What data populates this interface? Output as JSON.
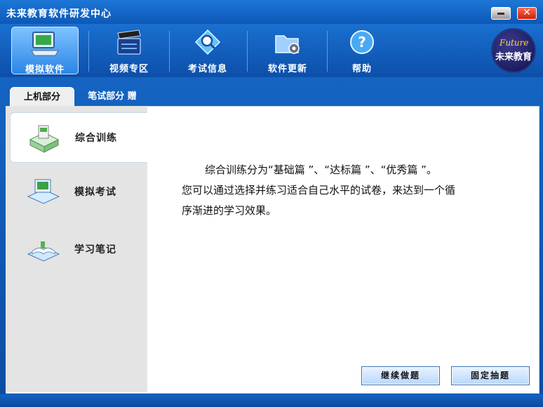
{
  "window": {
    "title": "未来教育软件研发中心",
    "close_glyph": "✕"
  },
  "toolbar": {
    "items": [
      {
        "label": "模拟软件",
        "icon": "computer-icon"
      },
      {
        "label": "视频专区",
        "icon": "film-clapper-icon"
      },
      {
        "label": "考试信息",
        "icon": "magnifier-icon"
      },
      {
        "label": "软件更新",
        "icon": "folder-gear-icon"
      },
      {
        "label": "帮助",
        "icon": "help-icon"
      }
    ],
    "logo": {
      "top": "Future",
      "bottom": "未来教育"
    }
  },
  "tabs": [
    {
      "label": "上机部分"
    },
    {
      "label": "笔试部分  赠"
    }
  ],
  "sidebar": {
    "items": [
      {
        "label": "综合训练",
        "icon": "box-training-icon"
      },
      {
        "label": "模拟考试",
        "icon": "computer-exam-icon"
      },
      {
        "label": "学习笔记",
        "icon": "book-notes-icon"
      }
    ]
  },
  "description": {
    "lines": [
      "综合训练分为“基础篇 ”、“达标篇 ”、“优秀篇 ”。",
      "您可以通过选择并练习适合自己水平的试卷，来达到一个循",
      "序渐进的学习效果。"
    ]
  },
  "buttons": {
    "continue": "继续做题",
    "fixed": "固定抽题"
  },
  "colors": {
    "accent": "#0d58b7",
    "panel": "#e4e4e4"
  }
}
